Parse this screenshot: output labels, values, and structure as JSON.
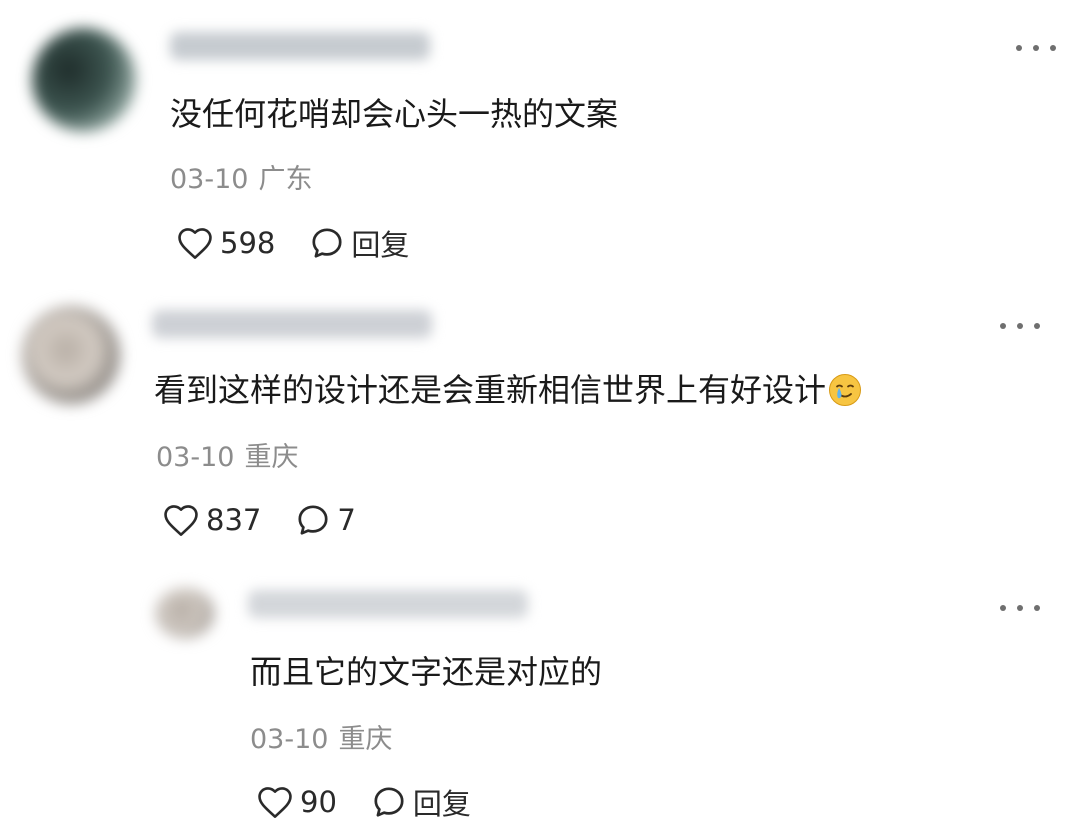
{
  "comments": [
    {
      "text": "没任何花哨却会心头一热的文案",
      "date": "03-10",
      "location": "广东",
      "likes": "598",
      "reply": "回复"
    },
    {
      "text": "看到这样的设计还是会重新相信世界上有好设计",
      "emoji": "crying-smile-emoji",
      "date": "03-10",
      "location": "重庆",
      "likes": "837",
      "reply_count": "7"
    },
    {
      "text": "而且它的文字还是对应的",
      "date": "03-10",
      "location": "重庆",
      "likes": "90",
      "reply": "回复"
    }
  ],
  "colors": {
    "text": "#1a1a1a",
    "meta": "#8c8c8c",
    "icon": "#2a2a2a",
    "background": "#ffffff"
  },
  "icons": {
    "like": "heart-outline-icon",
    "reply": "speech-bubble-icon",
    "more": "more-dots-icon"
  }
}
